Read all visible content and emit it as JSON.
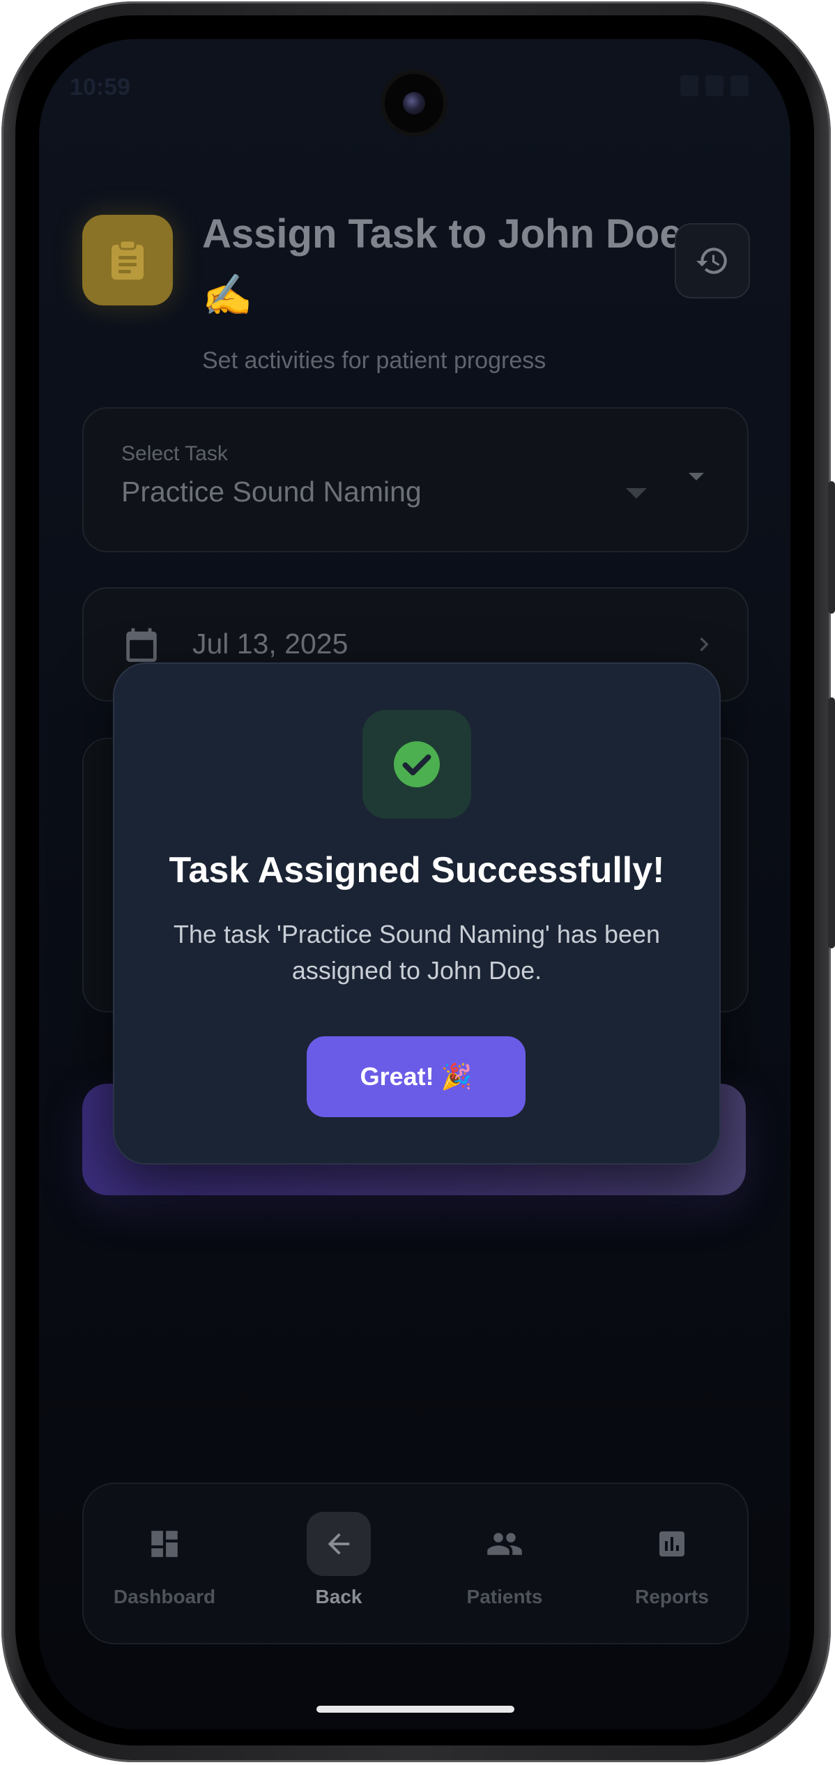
{
  "status_bar": {
    "time": "10:59"
  },
  "header": {
    "title": "Assign Task to John Doe ✍️",
    "subtitle": "Set activities for patient progress",
    "icon": "clipboard-icon",
    "history_icon": "history-icon"
  },
  "form": {
    "task_select": {
      "label": "Select Task",
      "value": "Practice Sound Naming"
    },
    "due_date": {
      "value": "Jul 13, 2025"
    }
  },
  "dialog": {
    "title": "Task Assigned Successfully!",
    "message": "The task 'Practice Sound Naming' has been assigned to John Doe.",
    "button_label": "Great! 🎉",
    "icon": "check-circle-icon",
    "accent": "#4caf50"
  },
  "bottom_nav": {
    "items": [
      {
        "label": "Dashboard",
        "icon": "dashboard-icon",
        "active": false
      },
      {
        "label": "Back",
        "icon": "arrow-back-icon",
        "active": true
      },
      {
        "label": "Patients",
        "icon": "people-icon",
        "active": false
      },
      {
        "label": "Reports",
        "icon": "bar-chart-icon",
        "active": false
      }
    ]
  },
  "colors": {
    "primary": "#6b5ce7",
    "header_icon_bg": "#8a7226",
    "success": "#4caf50",
    "dialog_bg": "#1b2434"
  }
}
